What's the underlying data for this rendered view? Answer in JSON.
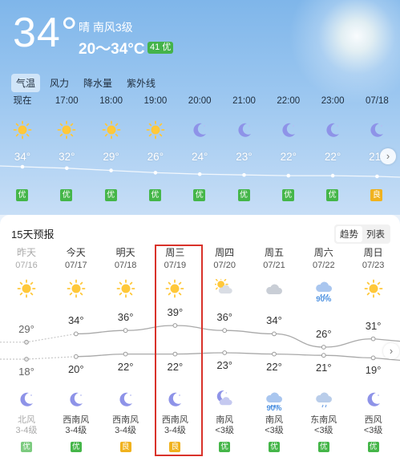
{
  "current": {
    "temp": "34°",
    "desc": "晴  南风3级",
    "range": "20～34°C",
    "aqi": "41 优"
  },
  "tabs": [
    "气温",
    "风力",
    "降水量",
    "紫外线"
  ],
  "hourly": [
    {
      "time": "现在",
      "icon": "sun-icon",
      "temp": "34°",
      "aqi": "优",
      "aqi_level": "good"
    },
    {
      "time": "17:00",
      "icon": "sun-icon",
      "temp": "32°",
      "aqi": "优",
      "aqi_level": "good"
    },
    {
      "time": "18:00",
      "icon": "sun-icon",
      "temp": "29°",
      "aqi": "优",
      "aqi_level": "good"
    },
    {
      "time": "19:00",
      "icon": "sun-icon",
      "temp": "26°",
      "aqi": "优",
      "aqi_level": "good"
    },
    {
      "time": "20:00",
      "icon": "moon-icon",
      "temp": "24°",
      "aqi": "优",
      "aqi_level": "good"
    },
    {
      "time": "21:00",
      "icon": "moon-icon",
      "temp": "23°",
      "aqi": "优",
      "aqi_level": "good"
    },
    {
      "time": "22:00",
      "icon": "moon-icon",
      "temp": "22°",
      "aqi": "优",
      "aqi_level": "good"
    },
    {
      "time": "23:00",
      "icon": "moon-icon",
      "temp": "22°",
      "aqi": "优",
      "aqi_level": "good"
    },
    {
      "time": "07/18",
      "icon": "moon-icon",
      "temp": "21°",
      "aqi": "良",
      "aqi_level": "fair"
    }
  ],
  "forecast": {
    "title": "15天预报",
    "view_trend": "趋势",
    "view_list": "列表",
    "days": [
      {
        "week": "昨天",
        "date": "07/16",
        "day_icon": "sun-icon",
        "day_precip": "",
        "high": "29°",
        "low": "18°",
        "night_icon": "moon-icon",
        "night_precip": "",
        "wind_dir": "北风",
        "wind_level": "3-4级",
        "aqi": "优",
        "aqi_level": "good",
        "past": true
      },
      {
        "week": "今天",
        "date": "07/17",
        "day_icon": "sun-icon",
        "day_precip": "",
        "high": "34°",
        "low": "20°",
        "night_icon": "moon-icon",
        "night_precip": "",
        "wind_dir": "西南风",
        "wind_level": "3-4级",
        "aqi": "优",
        "aqi_level": "good",
        "past": false
      },
      {
        "week": "明天",
        "date": "07/18",
        "day_icon": "sun-icon",
        "day_precip": "",
        "high": "36°",
        "low": "22°",
        "night_icon": "moon-icon",
        "night_precip": "",
        "wind_dir": "西南风",
        "wind_level": "3-4级",
        "aqi": "良",
        "aqi_level": "fair",
        "past": false
      },
      {
        "week": "周三",
        "date": "07/19",
        "day_icon": "sun-icon",
        "day_precip": "",
        "high": "39°",
        "low": "22°",
        "night_icon": "moon-icon",
        "night_precip": "",
        "wind_dir": "西南风",
        "wind_level": "3-4级",
        "aqi": "良",
        "aqi_level": "fair",
        "past": false
      },
      {
        "week": "周四",
        "date": "07/20",
        "day_icon": "partly-cloudy-icon",
        "day_precip": "",
        "high": "36°",
        "low": "23°",
        "night_icon": "moon-cloud-icon",
        "night_precip": "",
        "wind_dir": "南风",
        "wind_level": "<3级",
        "aqi": "优",
        "aqi_level": "good",
        "past": false
      },
      {
        "week": "周五",
        "date": "07/21",
        "day_icon": "cloud-icon",
        "day_precip": "",
        "high": "34°",
        "low": "22°",
        "night_icon": "rain-cloud-icon",
        "night_precip": "90%",
        "wind_dir": "南风",
        "wind_level": "<3级",
        "aqi": "优",
        "aqi_level": "good",
        "past": false
      },
      {
        "week": "周六",
        "date": "07/22",
        "day_icon": "rain-cloud-icon",
        "day_precip": "90%",
        "high": "26°",
        "low": "21°",
        "night_icon": "cloud-drizzle-icon",
        "night_precip": "",
        "wind_dir": "东南风",
        "wind_level": "<3级",
        "aqi": "优",
        "aqi_level": "good",
        "past": false
      },
      {
        "week": "周日",
        "date": "07/23",
        "day_icon": "sun-icon",
        "day_precip": "",
        "high": "31°",
        "low": "19°",
        "night_icon": "moon-icon",
        "night_precip": "",
        "wind_dir": "西风",
        "wind_level": "<3级",
        "aqi": "优",
        "aqi_level": "good",
        "past": false
      }
    ]
  },
  "colors": {
    "aqi_good": "#45b649",
    "aqi_fair": "#f0b21e",
    "highlight": "#d9322a"
  }
}
